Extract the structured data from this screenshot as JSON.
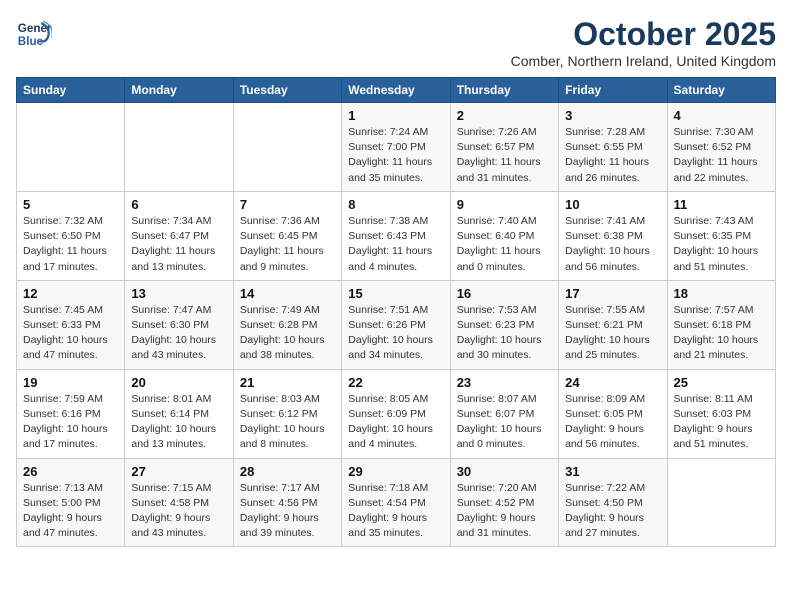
{
  "logo": {
    "line1": "General",
    "line2": "Blue"
  },
  "title": "October 2025",
  "location": "Comber, Northern Ireland, United Kingdom",
  "days_of_week": [
    "Sunday",
    "Monday",
    "Tuesday",
    "Wednesday",
    "Thursday",
    "Friday",
    "Saturday"
  ],
  "weeks": [
    [
      {
        "day": "",
        "detail": ""
      },
      {
        "day": "",
        "detail": ""
      },
      {
        "day": "",
        "detail": ""
      },
      {
        "day": "1",
        "detail": "Sunrise: 7:24 AM\nSunset: 7:00 PM\nDaylight: 11 hours\nand 35 minutes."
      },
      {
        "day": "2",
        "detail": "Sunrise: 7:26 AM\nSunset: 6:57 PM\nDaylight: 11 hours\nand 31 minutes."
      },
      {
        "day": "3",
        "detail": "Sunrise: 7:28 AM\nSunset: 6:55 PM\nDaylight: 11 hours\nand 26 minutes."
      },
      {
        "day": "4",
        "detail": "Sunrise: 7:30 AM\nSunset: 6:52 PM\nDaylight: 11 hours\nand 22 minutes."
      }
    ],
    [
      {
        "day": "5",
        "detail": "Sunrise: 7:32 AM\nSunset: 6:50 PM\nDaylight: 11 hours\nand 17 minutes."
      },
      {
        "day": "6",
        "detail": "Sunrise: 7:34 AM\nSunset: 6:47 PM\nDaylight: 11 hours\nand 13 minutes."
      },
      {
        "day": "7",
        "detail": "Sunrise: 7:36 AM\nSunset: 6:45 PM\nDaylight: 11 hours\nand 9 minutes."
      },
      {
        "day": "8",
        "detail": "Sunrise: 7:38 AM\nSunset: 6:43 PM\nDaylight: 11 hours\nand 4 minutes."
      },
      {
        "day": "9",
        "detail": "Sunrise: 7:40 AM\nSunset: 6:40 PM\nDaylight: 11 hours\nand 0 minutes."
      },
      {
        "day": "10",
        "detail": "Sunrise: 7:41 AM\nSunset: 6:38 PM\nDaylight: 10 hours\nand 56 minutes."
      },
      {
        "day": "11",
        "detail": "Sunrise: 7:43 AM\nSunset: 6:35 PM\nDaylight: 10 hours\nand 51 minutes."
      }
    ],
    [
      {
        "day": "12",
        "detail": "Sunrise: 7:45 AM\nSunset: 6:33 PM\nDaylight: 10 hours\nand 47 minutes."
      },
      {
        "day": "13",
        "detail": "Sunrise: 7:47 AM\nSunset: 6:30 PM\nDaylight: 10 hours\nand 43 minutes."
      },
      {
        "day": "14",
        "detail": "Sunrise: 7:49 AM\nSunset: 6:28 PM\nDaylight: 10 hours\nand 38 minutes."
      },
      {
        "day": "15",
        "detail": "Sunrise: 7:51 AM\nSunset: 6:26 PM\nDaylight: 10 hours\nand 34 minutes."
      },
      {
        "day": "16",
        "detail": "Sunrise: 7:53 AM\nSunset: 6:23 PM\nDaylight: 10 hours\nand 30 minutes."
      },
      {
        "day": "17",
        "detail": "Sunrise: 7:55 AM\nSunset: 6:21 PM\nDaylight: 10 hours\nand 25 minutes."
      },
      {
        "day": "18",
        "detail": "Sunrise: 7:57 AM\nSunset: 6:18 PM\nDaylight: 10 hours\nand 21 minutes."
      }
    ],
    [
      {
        "day": "19",
        "detail": "Sunrise: 7:59 AM\nSunset: 6:16 PM\nDaylight: 10 hours\nand 17 minutes."
      },
      {
        "day": "20",
        "detail": "Sunrise: 8:01 AM\nSunset: 6:14 PM\nDaylight: 10 hours\nand 13 minutes."
      },
      {
        "day": "21",
        "detail": "Sunrise: 8:03 AM\nSunset: 6:12 PM\nDaylight: 10 hours\nand 8 minutes."
      },
      {
        "day": "22",
        "detail": "Sunrise: 8:05 AM\nSunset: 6:09 PM\nDaylight: 10 hours\nand 4 minutes."
      },
      {
        "day": "23",
        "detail": "Sunrise: 8:07 AM\nSunset: 6:07 PM\nDaylight: 10 hours\nand 0 minutes."
      },
      {
        "day": "24",
        "detail": "Sunrise: 8:09 AM\nSunset: 6:05 PM\nDaylight: 9 hours\nand 56 minutes."
      },
      {
        "day": "25",
        "detail": "Sunrise: 8:11 AM\nSunset: 6:03 PM\nDaylight: 9 hours\nand 51 minutes."
      }
    ],
    [
      {
        "day": "26",
        "detail": "Sunrise: 7:13 AM\nSunset: 5:00 PM\nDaylight: 9 hours\nand 47 minutes."
      },
      {
        "day": "27",
        "detail": "Sunrise: 7:15 AM\nSunset: 4:58 PM\nDaylight: 9 hours\nand 43 minutes."
      },
      {
        "day": "28",
        "detail": "Sunrise: 7:17 AM\nSunset: 4:56 PM\nDaylight: 9 hours\nand 39 minutes."
      },
      {
        "day": "29",
        "detail": "Sunrise: 7:18 AM\nSunset: 4:54 PM\nDaylight: 9 hours\nand 35 minutes."
      },
      {
        "day": "30",
        "detail": "Sunrise: 7:20 AM\nSunset: 4:52 PM\nDaylight: 9 hours\nand 31 minutes."
      },
      {
        "day": "31",
        "detail": "Sunrise: 7:22 AM\nSunset: 4:50 PM\nDaylight: 9 hours\nand 27 minutes."
      },
      {
        "day": "",
        "detail": ""
      }
    ]
  ]
}
